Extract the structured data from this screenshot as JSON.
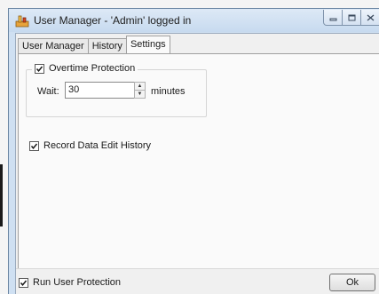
{
  "window": {
    "title": "User Manager - 'Admin' logged in",
    "caption_icons": [
      "minimize-icon",
      "maximize-icon",
      "close-icon"
    ]
  },
  "tabs": [
    {
      "label": "User Manager",
      "active": false
    },
    {
      "label": "History",
      "active": false
    },
    {
      "label": "Settings",
      "active": true
    }
  ],
  "settings": {
    "overtime": {
      "label": "Overtime Protection",
      "checked": true,
      "wait_label": "Wait:",
      "wait_value": "30",
      "unit": "minutes"
    },
    "record_history": {
      "label": "Record Data Edit History",
      "checked": true
    }
  },
  "footer": {
    "run_protection_label": "Run User Protection",
    "run_protection_checked": true,
    "ok_label": "Ok"
  },
  "colors": {
    "titlebar": "#cfe0f2",
    "panel": "#fafafa",
    "app_icon": "#e8a33a"
  }
}
